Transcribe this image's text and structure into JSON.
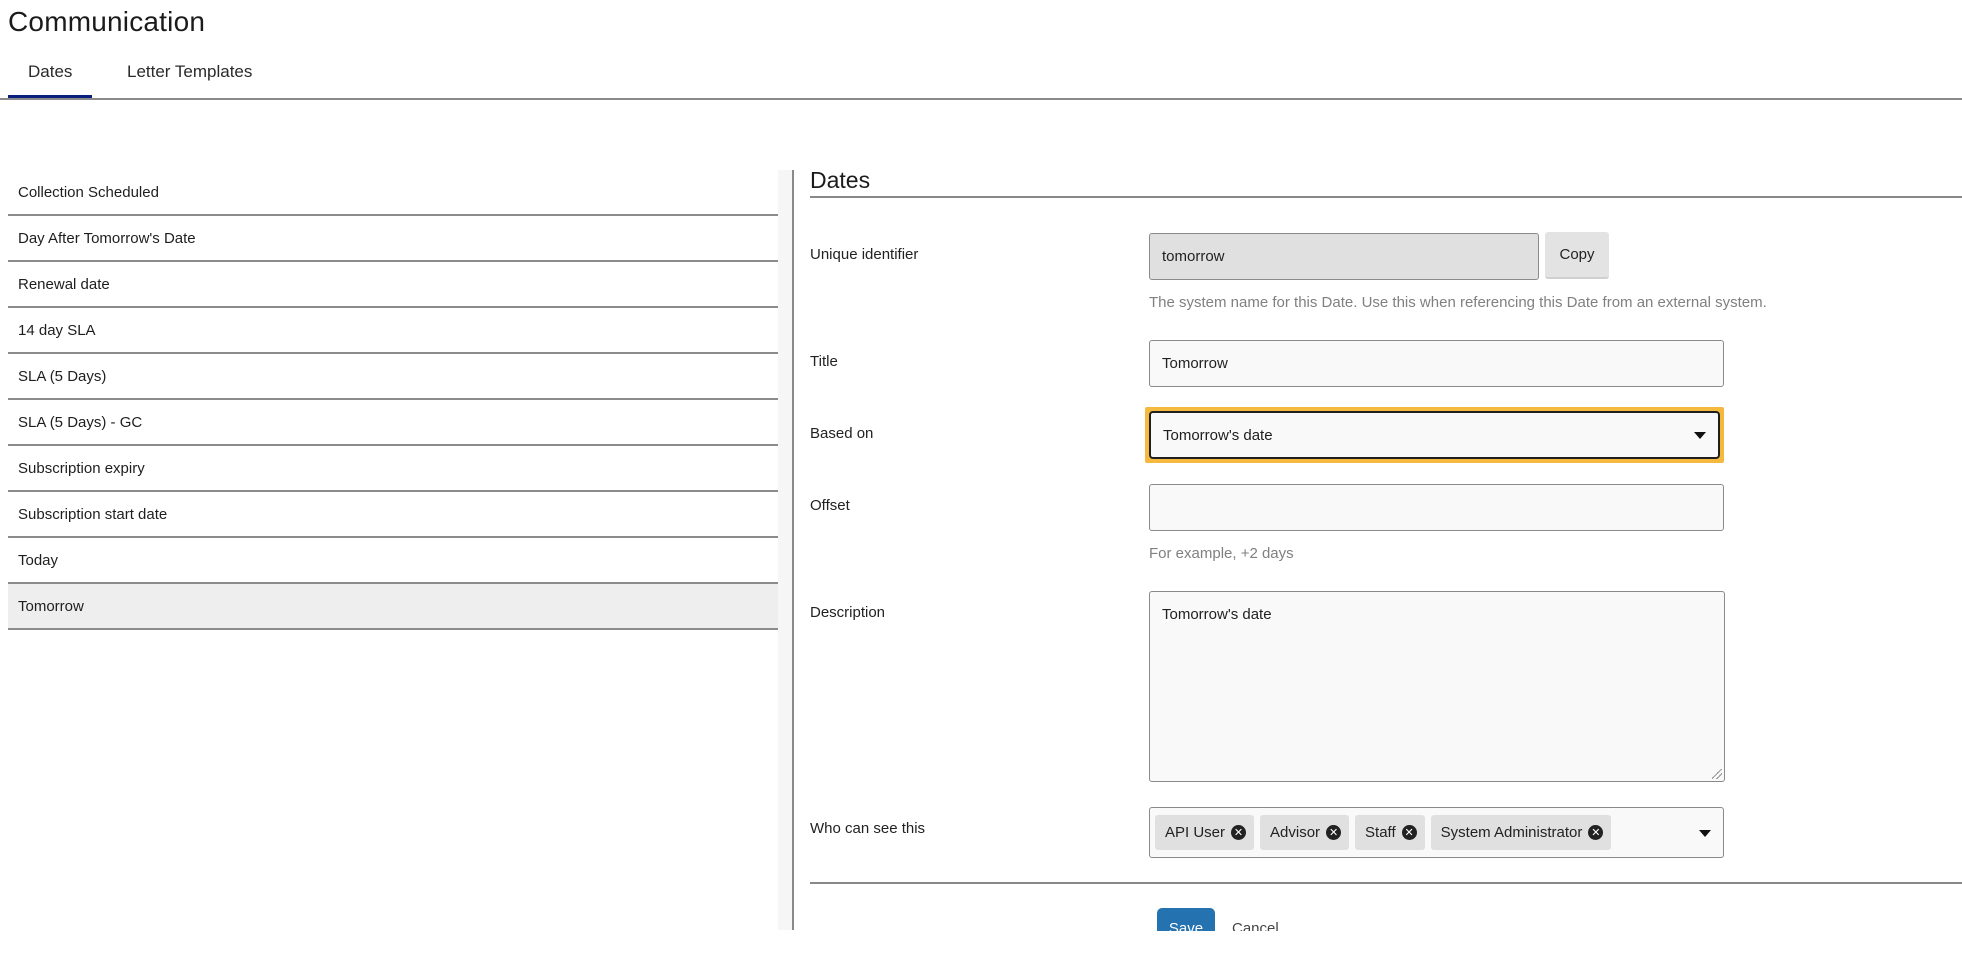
{
  "page": {
    "title": "Communication"
  },
  "tabs": [
    {
      "label": "Dates",
      "active": true
    },
    {
      "label": "Letter Templates",
      "active": false
    }
  ],
  "list": {
    "items": [
      {
        "label": "Collection Scheduled",
        "selected": false
      },
      {
        "label": "Day After Tomorrow's Date",
        "selected": false
      },
      {
        "label": "Renewal date",
        "selected": false
      },
      {
        "label": "14 day SLA",
        "selected": false
      },
      {
        "label": "SLA (5 Days)",
        "selected": false
      },
      {
        "label": "SLA (5 Days) - GC",
        "selected": false
      },
      {
        "label": "Subscription expiry",
        "selected": false
      },
      {
        "label": "Subscription start date",
        "selected": false
      },
      {
        "label": "Today",
        "selected": false
      },
      {
        "label": "Tomorrow",
        "selected": true
      }
    ]
  },
  "form": {
    "heading": "Dates",
    "unique_identifier": {
      "label": "Unique identifier",
      "value": "tomorrow",
      "copy_label": "Copy",
      "help": "The system name for this Date. Use this when referencing this Date from an external system."
    },
    "title": {
      "label": "Title",
      "value": "Tomorrow"
    },
    "based_on": {
      "label": "Based on",
      "value": "Tomorrow's date"
    },
    "offset": {
      "label": "Offset",
      "value": "",
      "help": "For example, +2 days"
    },
    "description": {
      "label": "Description",
      "value": "Tomorrow's date"
    },
    "visibility": {
      "label": "Who can see this",
      "tags": [
        "API User",
        "Advisor",
        "Staff",
        "System Administrator"
      ]
    },
    "save_label": "Save",
    "cancel_label": "Cancel"
  },
  "colors": {
    "active_tab": "#0b1f7c",
    "focus_ring": "#f5b93f",
    "primary_button": "#2472b0",
    "selected_row": "#eeeeee"
  }
}
